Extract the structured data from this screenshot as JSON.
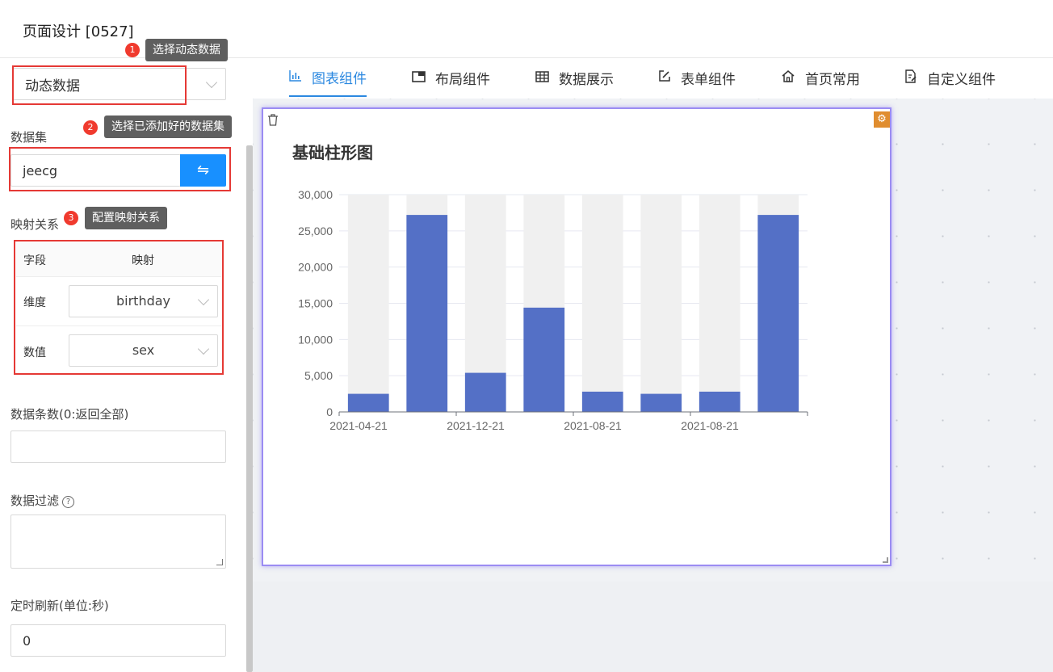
{
  "page_title": "页面设计 [0527]",
  "sidebar": {
    "source_select_value": "动态数据",
    "dataset_label": "数据集",
    "dataset_value": "jeecg",
    "dataset_button_icon": "swap-icon",
    "mapping_label": "映射关系",
    "mapping_header": {
      "field": "字段",
      "mapping": "映射"
    },
    "mapping_rows": [
      {
        "field": "维度",
        "value": "birthday"
      },
      {
        "field": "数值",
        "value": "sex"
      }
    ],
    "count_label": "数据条数(0:返回全部)",
    "count_value": "",
    "filter_label": "数据过滤",
    "refresh_label": "定时刷新(单位:秒)",
    "refresh_value": "0"
  },
  "annotations": [
    {
      "num": "1",
      "text": "选择动态数据"
    },
    {
      "num": "2",
      "text": "选择已添加好的数据集"
    },
    {
      "num": "3",
      "text": "配置映射关系"
    }
  ],
  "tabs": [
    {
      "label": "图表组件",
      "icon": "bar-chart-icon",
      "active": true
    },
    {
      "label": "布局组件",
      "icon": "layout-icon",
      "active": false
    },
    {
      "label": "数据展示",
      "icon": "table-icon",
      "active": false
    },
    {
      "label": "表单组件",
      "icon": "form-edit-icon",
      "active": false
    },
    {
      "label": "首页常用",
      "icon": "home-icon",
      "active": false
    },
    {
      "label": "自定义组件",
      "icon": "custom-file-icon",
      "active": false
    }
  ],
  "colors": {
    "accent": "#2b88e0",
    "bar": "#5470c6",
    "bar_bg": "#f0f0f0",
    "annotation_red": "#e53935"
  },
  "chart_data": {
    "type": "bar",
    "title": "基础柱形图",
    "categories": [
      "2021-04-21",
      "",
      "2021-12-21",
      "",
      "2021-08-21",
      "",
      "2021-08-21",
      ""
    ],
    "values": [
      2500,
      27200,
      5400,
      14400,
      2800,
      2500,
      2800,
      27200
    ],
    "ylim": [
      0,
      30000
    ],
    "yticks": [
      "0",
      "5,000",
      "10,000",
      "15,000",
      "20,000",
      "25,000",
      "30,000"
    ],
    "background_bars": true,
    "grid": true
  }
}
